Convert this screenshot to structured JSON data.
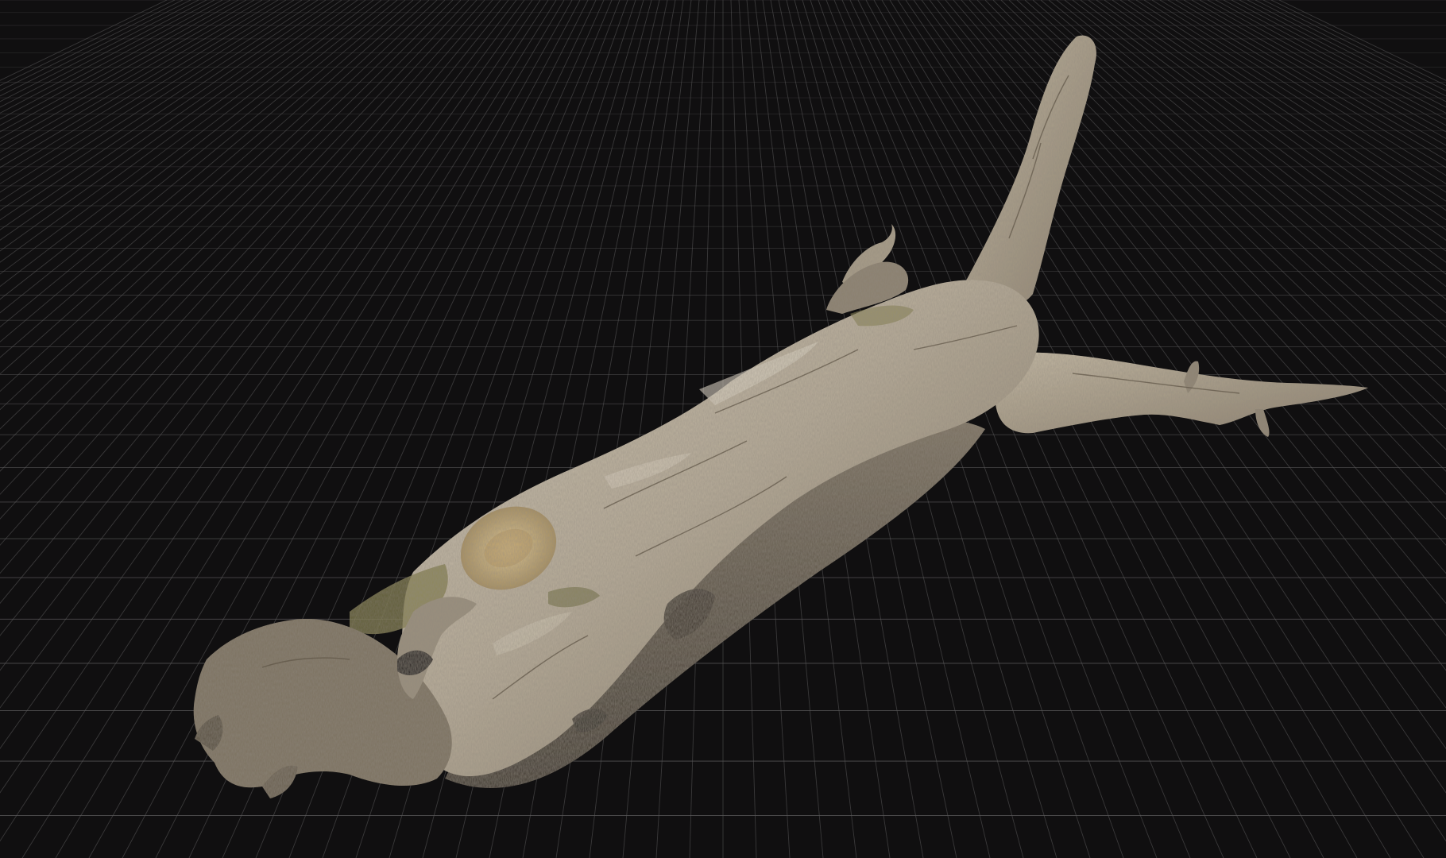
{
  "viewport": {
    "background_color": "#100f10",
    "grid_color": "#5c5b5c",
    "grid_visible": true
  },
  "model": {
    "subject": "driftwood-log",
    "bark_light_color": "#c8bfae",
    "bark_mid_color": "#9c917f",
    "bark_dark_color": "#4d4539",
    "moss_color": "#7f7a45",
    "cut_end_color": "#c9b07a"
  }
}
